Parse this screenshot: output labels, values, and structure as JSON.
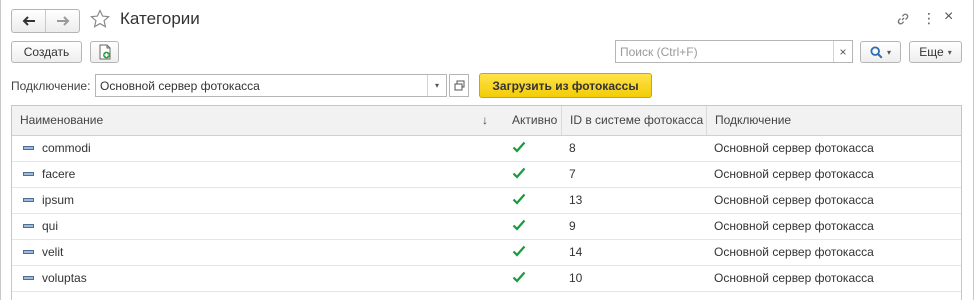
{
  "window": {
    "title": "Категории",
    "icons": {
      "back": "arrow-left-icon",
      "forward": "arrow-right-icon",
      "favorite": "star-icon",
      "link": "link-icon",
      "more": "more-vertical-icon",
      "close": "close-icon"
    },
    "more_glyph": "⋮",
    "close_glyph": "×"
  },
  "toolbar": {
    "create_label": "Создать",
    "search_placeholder": "Поиск (Ctrl+F)",
    "search_value": "",
    "search_clear_glyph": "×",
    "more_label": "Еще",
    "caret_glyph": "▾"
  },
  "connection": {
    "label": "Подключение:",
    "value": "Основной сервер фотокасса",
    "load_button_label": "Загрузить из фотокассы"
  },
  "table": {
    "columns": [
      "Наименование",
      "Активно",
      "ID в системе фотокасса",
      "Подключение"
    ],
    "sort_glyph": "↓",
    "rows": [
      {
        "name": "commodi",
        "active": true,
        "id": "8",
        "connection": "Основной сервер фотокасса"
      },
      {
        "name": "facere",
        "active": true,
        "id": "7",
        "connection": "Основной сервер фотокасса"
      },
      {
        "name": "ipsum",
        "active": true,
        "id": "13",
        "connection": "Основной сервер фотокасса"
      },
      {
        "name": "qui",
        "active": true,
        "id": "9",
        "connection": "Основной сервер фотокасса"
      },
      {
        "name": "velit",
        "active": true,
        "id": "14",
        "connection": "Основной сервер фотокасса"
      },
      {
        "name": "voluptas",
        "active": true,
        "id": "10",
        "connection": "Основной сервер фотокасса"
      }
    ]
  },
  "colors": {
    "accent_yellow": "#f3cd07",
    "check_green": "#1a9a3c",
    "search_blue": "#2b6cb0"
  }
}
